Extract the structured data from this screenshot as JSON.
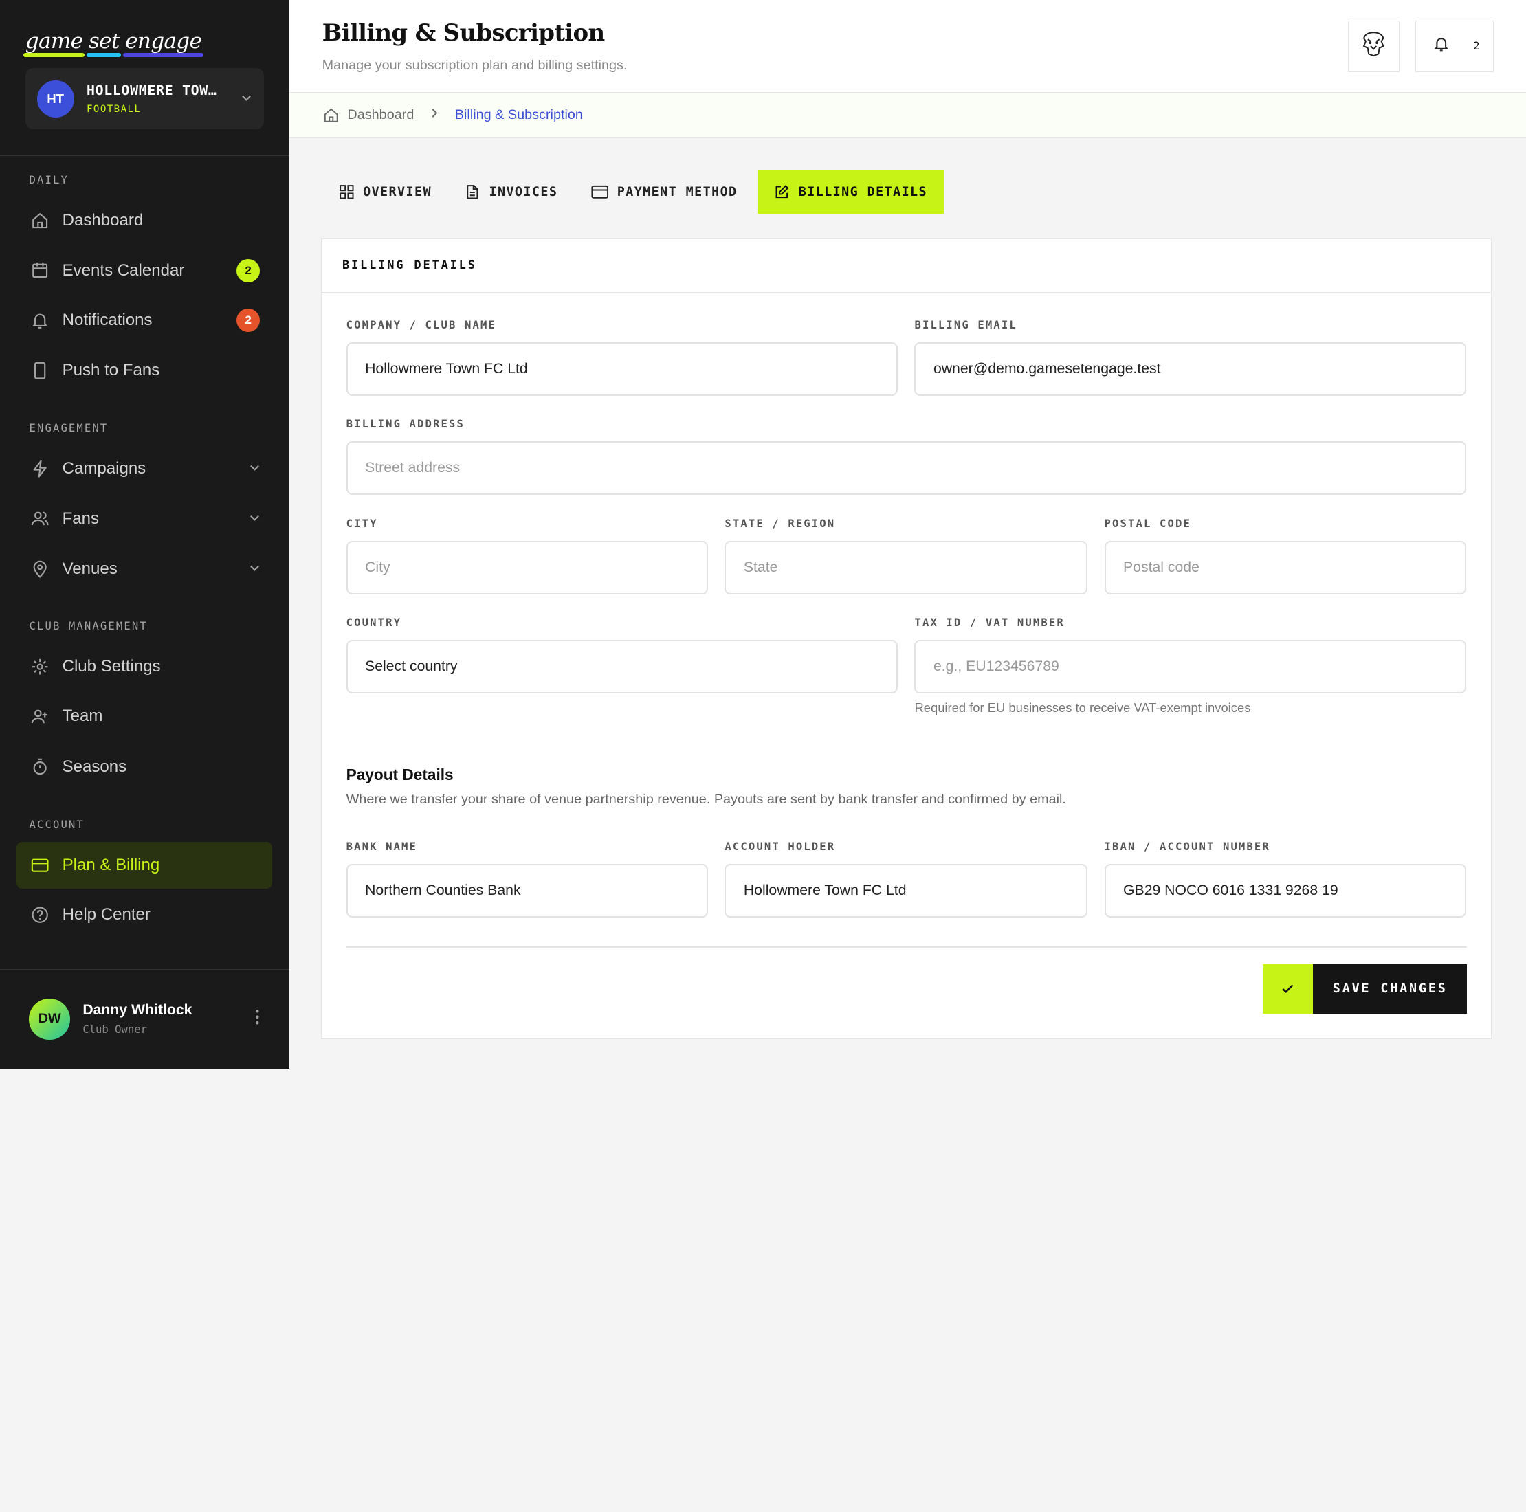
{
  "brand": {
    "word1": "game",
    "word2": "set",
    "word3": "engage"
  },
  "club": {
    "initials": "HT",
    "name": "HOLLOWMERE TOWN FC",
    "sport": "FOOTBALL"
  },
  "sidebar": {
    "sections": {
      "daily": "DAILY",
      "engagement": "ENGAGEMENT",
      "club_management": "CLUB MANAGEMENT",
      "account": "ACCOUNT"
    },
    "items": {
      "dashboard": "Dashboard",
      "events_calendar": "Events Calendar",
      "events_badge": "2",
      "notifications": "Notifications",
      "notifications_badge": "2",
      "push_to_fans": "Push to Fans",
      "campaigns": "Campaigns",
      "fans": "Fans",
      "venues": "Venues",
      "club_settings": "Club Settings",
      "team": "Team",
      "seasons": "Seasons",
      "plan_billing": "Plan & Billing",
      "help_center": "Help Center"
    }
  },
  "user": {
    "initials": "DW",
    "name": "Danny Whitlock",
    "role": "Club Owner"
  },
  "header": {
    "title": "Billing & Subscription",
    "subtitle": "Manage your subscription plan and billing settings.",
    "notification_count": "2"
  },
  "breadcrumb": {
    "home": "Dashboard",
    "current": "Billing & Subscription"
  },
  "tabs": {
    "overview": "OVERVIEW",
    "invoices": "INVOICES",
    "payment_method": "PAYMENT METHOD",
    "billing_details": "BILLING DETAILS"
  },
  "card": {
    "title": "BILLING DETAILS"
  },
  "form": {
    "company": {
      "label": "COMPANY / CLUB NAME",
      "value": "Hollowmere Town FC Ltd"
    },
    "email": {
      "label": "BILLING EMAIL",
      "value": "owner@demo.gamesetengage.test"
    },
    "address": {
      "label": "BILLING ADDRESS",
      "placeholder": "Street address"
    },
    "city": {
      "label": "CITY",
      "placeholder": "City"
    },
    "state": {
      "label": "STATE / REGION",
      "placeholder": "State"
    },
    "postal": {
      "label": "POSTAL CODE",
      "placeholder": "Postal code"
    },
    "country": {
      "label": "COUNTRY",
      "value": "Select country"
    },
    "tax": {
      "label": "TAX ID / VAT NUMBER",
      "placeholder": "e.g., EU123456789",
      "hint": "Required for EU businesses to receive VAT-exempt invoices"
    }
  },
  "payout": {
    "title": "Payout Details",
    "description": "Where we transfer your share of venue partnership revenue. Payouts are sent by bank transfer and confirmed by email.",
    "bank": {
      "label": "BANK NAME",
      "value": "Northern Counties Bank"
    },
    "holder": {
      "label": "ACCOUNT HOLDER",
      "value": "Hollowmere Town FC Ltd"
    },
    "iban": {
      "label": "IBAN / ACCOUNT NUMBER",
      "value": "GB29 NOCO 6016 1331 9268 19"
    }
  },
  "actions": {
    "save": "SAVE CHANGES"
  },
  "colors": {
    "accent": "#c8f316",
    "brand_blue": "#3b4fd8",
    "alert": "#e5532a",
    "sidebar": "#1a1a1a"
  }
}
